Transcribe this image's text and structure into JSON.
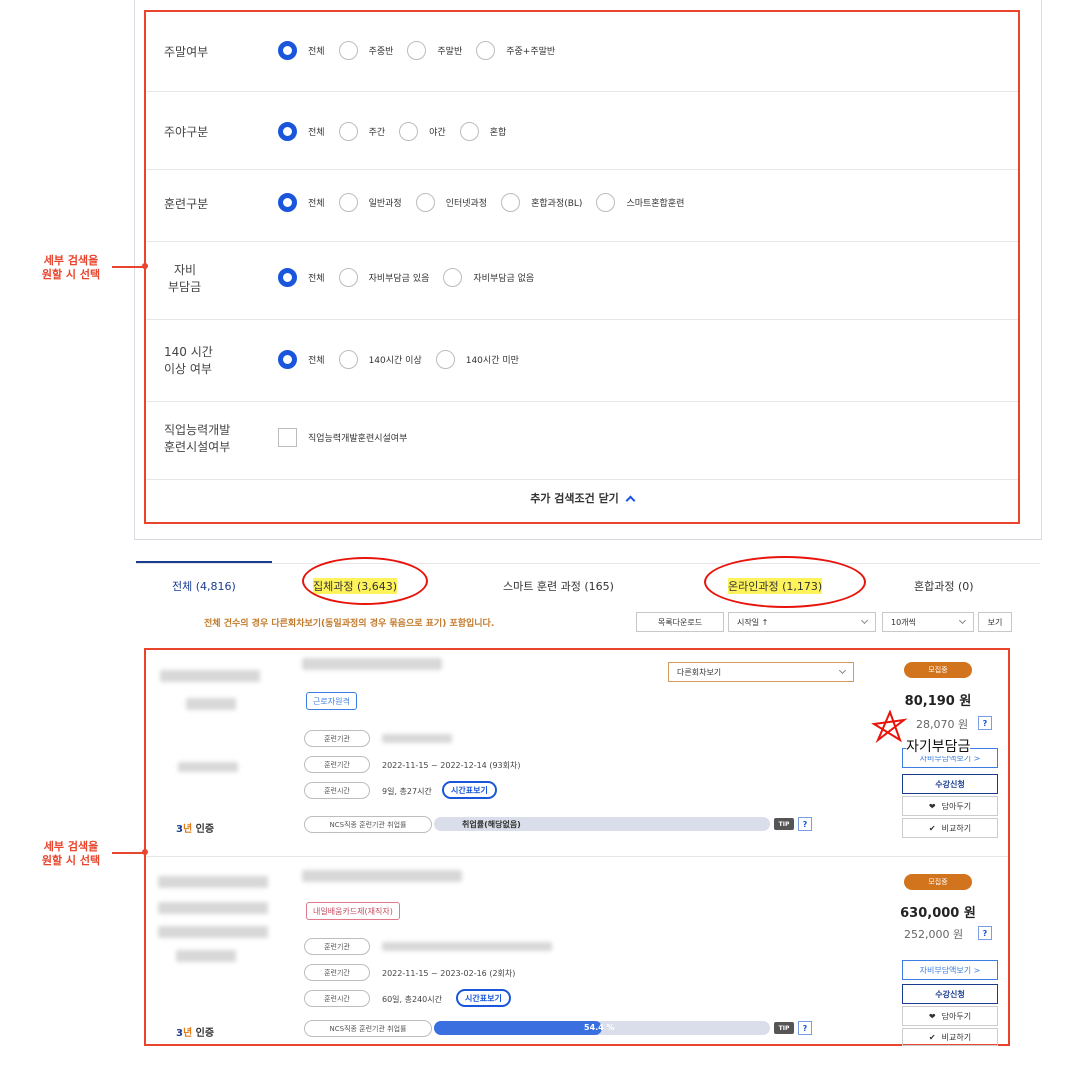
{
  "filters": {
    "weekend": {
      "label": "주말여부",
      "options": [
        "전체",
        "주중반",
        "주말반",
        "주중+주말반"
      ]
    },
    "dayNight": {
      "label": "주야구분",
      "options": [
        "전체",
        "주간",
        "야간",
        "혼합"
      ]
    },
    "training": {
      "label": "훈련구분",
      "options": [
        "전체",
        "일반과정",
        "인터넷과정",
        "혼합과정(BL)",
        "스마트혼합훈련"
      ]
    },
    "selfPay": {
      "label_line1": "자비",
      "label_line2": "부담금",
      "options": [
        "전체",
        "자비부담금 있음",
        "자비부담금 없음"
      ]
    },
    "hours": {
      "label_line1": "140 시간",
      "label_line2": "이상 여부",
      "options": [
        "전체",
        "140시간 이상",
        "140시간 미만"
      ]
    },
    "facility": {
      "label_line1": "직업능력개발",
      "label_line2": "훈련시설여부",
      "checkbox_label": "직업능력개발훈련시설여부"
    },
    "close_label": "추가 검색조건 닫기"
  },
  "annotations": {
    "top_line1": "세부 검색을",
    "top_line2": "원할 시 선택",
    "bottom_line1": "세부 검색을",
    "bottom_line2": "원할 시 선택",
    "self_pay_note": "자기부담금"
  },
  "tabs": [
    {
      "label": "전체 (4,816)"
    },
    {
      "label": "집체과정 (3,643)"
    },
    {
      "label": "스마트 훈련 과정 (165)"
    },
    {
      "label": "온라인과정 (1,173)"
    },
    {
      "label": "혼합과정 (0)"
    }
  ],
  "toolbar": {
    "notice": "전체 건수의 경우 다른회차보기(동일과정의 경우 묶음으로 표기) 포함입니다.",
    "download": "목록다운로드",
    "sort": "시작일 ↑",
    "per_page": "10개씩",
    "view": "보기"
  },
  "courses": [
    {
      "badge": "근로자원격",
      "other_round": "다른회차보기",
      "org_label": "훈련기관",
      "period_label": "훈련기간",
      "period": "2022-11-15 ~ 2022-12-14 (93회차)",
      "time_label": "훈련시간",
      "time": "9일, 총27시간",
      "timetable": "시간표보기",
      "ncs_label": "NCS직종 훈련기관 취업률",
      "ncs_text": "취업률(해당없음)",
      "ncs_pct": 0,
      "tip": "TIP",
      "q": "?",
      "status": "모집중",
      "price": "80,190 원",
      "self_price": "28,070 원",
      "self_btn": "자비부담액보기 >",
      "apply": "수강신청",
      "save": "담아두기",
      "compare": "비교하기",
      "cert_num": "3",
      "cert_unit": "년",
      "cert_text": "인증"
    },
    {
      "badge": "내일배움카드제(재직자)",
      "org_label": "훈련기관",
      "period_label": "훈련기간",
      "period": "2022-11-15 ~ 2023-02-16 (2회차)",
      "time_label": "훈련시간",
      "time": "60일, 총240시간",
      "timetable": "시간표보기",
      "ncs_label": "NCS직종 훈련기관 취업률",
      "ncs_text": "54.4 %",
      "ncs_pct": 0.5,
      "tip": "TIP",
      "q": "?",
      "status": "모집중",
      "price": "630,000 원",
      "self_price": "252,000 원",
      "self_btn": "자비부담액보기 >",
      "apply": "수강신청",
      "save": "담아두기",
      "compare": "비교하기",
      "cert_num": "3",
      "cert_unit": "년",
      "cert_text": "인증"
    }
  ]
}
